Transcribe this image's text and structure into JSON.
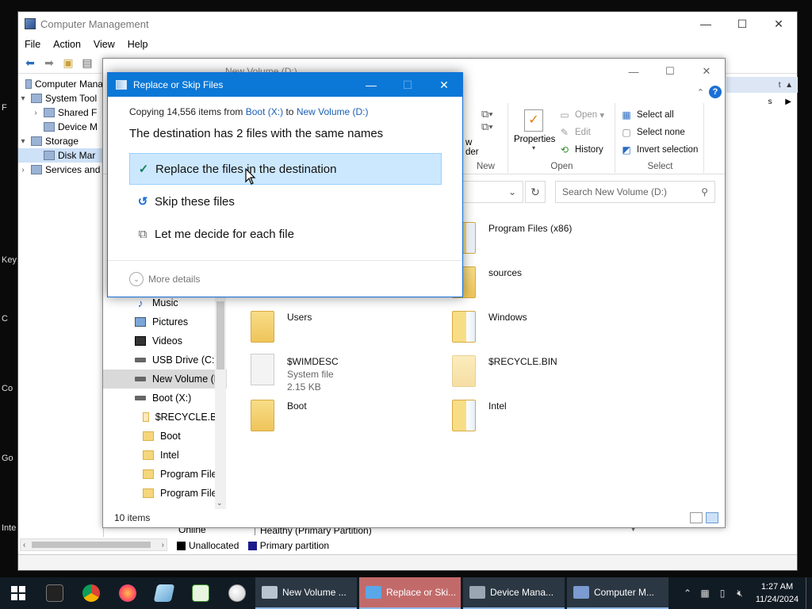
{
  "desktop": {
    "labels": [
      "F",
      "Key",
      "C",
      "Co",
      "Go",
      "Inte"
    ]
  },
  "computer_management": {
    "title": "Computer Management",
    "menu": [
      "File",
      "Action",
      "View",
      "Help"
    ],
    "tree": [
      {
        "label": "Computer Mana",
        "exp": ""
      },
      {
        "label": "System Tool",
        "exp": "▾"
      },
      {
        "label": "Shared F",
        "exp": "›"
      },
      {
        "label": "Device M",
        "exp": ""
      },
      {
        "label": "Storage",
        "exp": "▾"
      },
      {
        "label": "Disk Mar",
        "exp": ""
      },
      {
        "label": "Services and",
        "exp": "›"
      }
    ],
    "right_panel": {
      "header": "t",
      "more": "s"
    },
    "disk": {
      "state": "Online",
      "partition": "Healthy (Primary Partition)",
      "legend_unallocated": "Unallocated",
      "legend_primary": "Primary partition"
    }
  },
  "explorer": {
    "title": "New Volume (D:)",
    "ribbon": {
      "new_partial": "w\nder",
      "new_label": "New",
      "properties": "Properties",
      "open": "Open",
      "edit": "Edit",
      "history": "History",
      "open_label": "Open",
      "select_all": "Select all",
      "select_none": "Select none",
      "invert": "Invert selection",
      "select_label": "Select"
    },
    "search_placeholder": "Search New Volume (D:)",
    "nav": [
      {
        "label": "Music",
        "icon": "music"
      },
      {
        "label": "Pictures",
        "icon": "pic"
      },
      {
        "label": "Videos",
        "icon": "vid"
      },
      {
        "label": "USB Drive (C:)",
        "icon": "drive"
      },
      {
        "label": "New Volume (D",
        "icon": "drive",
        "selected": true
      },
      {
        "label": "Boot (X:)",
        "icon": "drive"
      },
      {
        "label": "$RECYCLE.BIN",
        "icon": "folder",
        "sub": true
      },
      {
        "label": "Boot",
        "icon": "folder",
        "sub": true
      },
      {
        "label": "Intel",
        "icon": "folder",
        "sub": true
      },
      {
        "label": "Program Files",
        "icon": "folder",
        "sub": true
      },
      {
        "label": "Program Files",
        "icon": "folder",
        "sub": true
      }
    ],
    "files": [
      {
        "name": "Program Files (x86)",
        "col": 1,
        "row": 0
      },
      {
        "name": "sources",
        "col": 1,
        "row": 1
      },
      {
        "name": "Users",
        "col": 0,
        "row": 2
      },
      {
        "name": "Windows",
        "col": 1,
        "row": 2
      },
      {
        "name": "$WIMDESC",
        "col": 0,
        "row": 3,
        "type": "System file",
        "size": "2.15 KB"
      },
      {
        "name": "$RECYCLE.BIN",
        "col": 1,
        "row": 3
      },
      {
        "name": "Boot",
        "col": 0,
        "row": 4
      },
      {
        "name": "Intel",
        "col": 1,
        "row": 4
      }
    ],
    "status": "10 items"
  },
  "dialog": {
    "title": "Replace or Skip Files",
    "copy_prefix": "Copying 14,556 items from",
    "source": "Boot (X:)",
    "to": "to",
    "dest": "New Volume (D:)",
    "headline": "The destination has 2 files with the same names",
    "opt_replace": "Replace the files in the destination",
    "opt_skip": "Skip these files",
    "opt_decide": "Let me decide for each file",
    "more_details": "More details"
  },
  "taskbar": {
    "tasks": [
      {
        "label": "New Volume ...",
        "active": false,
        "color": "#b8c4cf"
      },
      {
        "label": "Replace or Ski...",
        "active": true,
        "color": "#5aa7e8"
      },
      {
        "label": "Device Mana...",
        "active": false,
        "color": "#9aa6b2"
      },
      {
        "label": "Computer M...",
        "active": false,
        "color": "#7b9bd1"
      }
    ],
    "time": "1:27 AM",
    "date": "11/24/2024"
  }
}
